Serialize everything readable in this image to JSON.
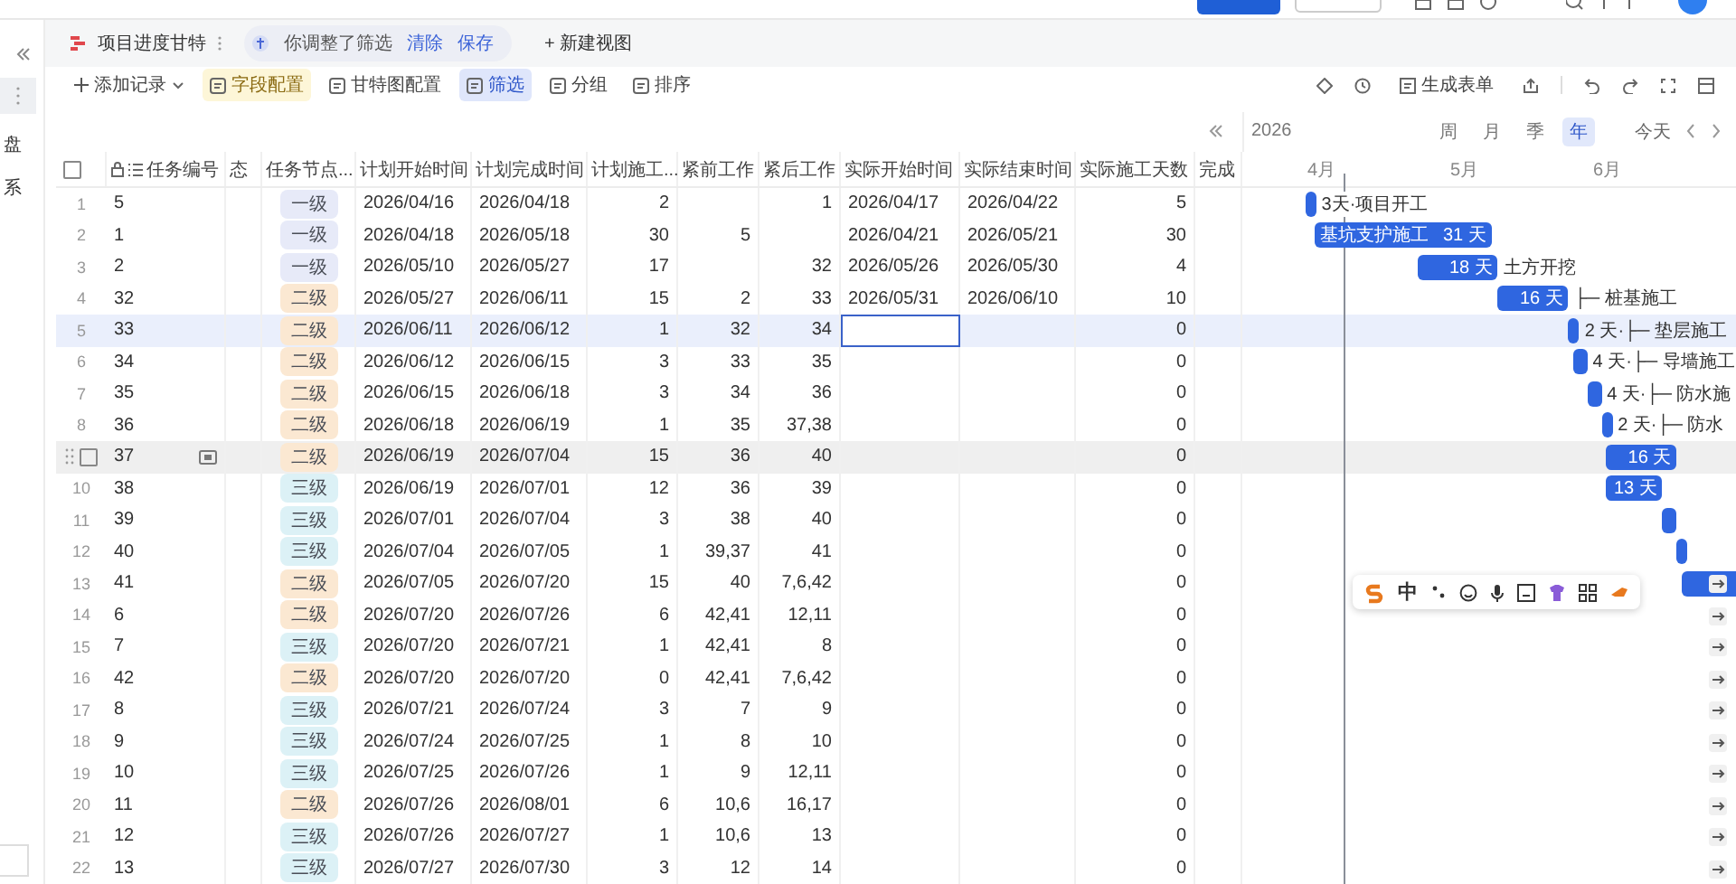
{
  "sidebar": {
    "items": [
      {
        "kind": "more",
        "selected": true
      },
      {
        "kind": "text",
        "label": "盘",
        "selected": false
      },
      {
        "kind": "text",
        "label": "系",
        "selected": false
      }
    ]
  },
  "view_tabs": {
    "title": "项目进度甘特",
    "notice": "你调整了筛选",
    "clear": "清除",
    "save": "保存",
    "new_view": "+ 新建视图"
  },
  "toolbar": {
    "left": [
      {
        "label": "添加记录",
        "kind": "add"
      },
      {
        "label": "字段配置",
        "kind": "warn"
      },
      {
        "label": "甘特图配置",
        "kind": "plain"
      },
      {
        "label": "筛选",
        "kind": "active"
      },
      {
        "label": "分组",
        "kind": "plain"
      },
      {
        "label": "排序",
        "kind": "plain"
      }
    ],
    "form": "生成表单"
  },
  "timeline": {
    "year": "2026",
    "scales": [
      {
        "label": "周",
        "selected": false
      },
      {
        "label": "月",
        "selected": false
      },
      {
        "label": "季",
        "selected": false
      },
      {
        "label": "年",
        "selected": true
      }
    ],
    "today": "今天"
  },
  "table": {
    "columns": [
      "任务编号",
      "态",
      "任务节点...",
      "计划开始时间",
      "计划完成时间",
      "计划施工...",
      "紧前工作",
      "紧后工作",
      "实际开始时间",
      "实际结束时间",
      "实际施工天数",
      "完成"
    ],
    "all_checked": false,
    "rows": [
      {
        "num": "1",
        "task_id": "5",
        "node": "一级",
        "color": "#e7eaf8",
        "plan_start": "2026/04/16",
        "plan_end": "2026/04/18",
        "plan_days": "2",
        "succ": "1",
        "act_start": "2026/04/17",
        "act_end": "2026/04/22",
        "act_days": "5",
        "selected": false,
        "hovered": false,
        "bar": {
          "outside": "3天·项目开工"
        }
      },
      {
        "num": "2",
        "task_id": "1",
        "node": "一级",
        "color": "#e7eaf8",
        "plan_start": "2026/04/18",
        "plan_end": "2026/05/18",
        "plan_days": "30",
        "pred": "5",
        "act_start": "2026/04/21",
        "act_end": "2026/05/21",
        "act_days": "30",
        "selected": false,
        "hovered": false,
        "bar": {
          "name": "基坑支护施工",
          "days": "31 天"
        }
      },
      {
        "num": "3",
        "task_id": "2",
        "node": "一级",
        "color": "#e7eaf8",
        "plan_start": "2026/05/10",
        "plan_end": "2026/05/27",
        "plan_days": "17",
        "succ": "32",
        "act_start": "2026/05/26",
        "act_end": "2026/05/30",
        "act_days": "4",
        "selected": false,
        "hovered": false,
        "bar": {
          "days": "18 天",
          "outside": "土方开挖"
        }
      },
      {
        "num": "4",
        "task_id": "32",
        "node": "二级",
        "color": "#fbe8d2",
        "plan_start": "2026/05/27",
        "plan_end": "2026/06/11",
        "plan_days": "15",
        "pred": "2",
        "succ": "33",
        "act_start": "2026/05/31",
        "act_end": "2026/06/10",
        "act_days": "10",
        "selected": false,
        "hovered": false,
        "bar": {
          "days": "16 天",
          "outside": "├─ 桩基施工"
        }
      },
      {
        "num": "5",
        "task_id": "33",
        "node": "二级",
        "color": "#fbe8d2",
        "plan_start": "2026/06/11",
        "plan_end": "2026/06/12",
        "plan_days": "1",
        "pred": "32",
        "succ": "34",
        "act_days": "0",
        "selected": true,
        "hovered": false,
        "focus_cell": true,
        "bar": {
          "outside": "2 天·├─ 垫层施工"
        }
      },
      {
        "num": "6",
        "task_id": "34",
        "node": "二级",
        "color": "#fbe8d2",
        "plan_start": "2026/06/12",
        "plan_end": "2026/06/15",
        "plan_days": "3",
        "pred": "33",
        "succ": "35",
        "act_days": "0",
        "selected": false,
        "hovered": false,
        "bar": {
          "outside": "4 天·├─ 导墙施工"
        }
      },
      {
        "num": "7",
        "task_id": "35",
        "node": "二级",
        "color": "#fbe8d2",
        "plan_start": "2026/06/15",
        "plan_end": "2026/06/18",
        "plan_days": "3",
        "pred": "34",
        "succ": "36",
        "act_days": "0",
        "selected": false,
        "hovered": false,
        "bar": {
          "outside": "4 天·├─ 防水施"
        }
      },
      {
        "num": "8",
        "task_id": "36",
        "node": "二级",
        "color": "#fbe8d2",
        "plan_start": "2026/06/18",
        "plan_end": "2026/06/19",
        "plan_days": "1",
        "pred": "35",
        "succ": "37,38",
        "act_days": "0",
        "selected": false,
        "hovered": false,
        "bar": {
          "outside": "2 天·├─ 防水"
        }
      },
      {
        "checked": false,
        "task_id": "37",
        "node": "二级",
        "color": "#fbe8d2",
        "plan_start": "2026/06/19",
        "plan_end": "2026/07/04",
        "plan_days": "15",
        "pred": "36",
        "succ": "40",
        "act_days": "0",
        "selected": false,
        "hovered": true,
        "bar": {
          "days": "16 天"
        }
      },
      {
        "num": "10",
        "task_id": "38",
        "node": "三级",
        "color": "#dcf1f6",
        "plan_start": "2026/06/19",
        "plan_end": "2026/07/01",
        "plan_days": "12",
        "pred": "36",
        "succ": "39",
        "act_days": "0",
        "selected": false,
        "hovered": false,
        "bar": {
          "days": "13 天"
        }
      },
      {
        "num": "11",
        "task_id": "39",
        "node": "三级",
        "color": "#dcf1f6",
        "plan_start": "2026/07/01",
        "plan_end": "2026/07/04",
        "plan_days": "3",
        "pred": "38",
        "succ": "40",
        "act_days": "0",
        "selected": false,
        "hovered": false
      },
      {
        "num": "12",
        "task_id": "40",
        "node": "三级",
        "color": "#dcf1f6",
        "plan_start": "2026/07/04",
        "plan_end": "2026/07/05",
        "plan_days": "1",
        "pred": "39,37",
        "succ": "41",
        "act_days": "0",
        "selected": false,
        "hovered": false
      },
      {
        "num": "13",
        "task_id": "41",
        "node": "二级",
        "color": "#fbe8d2",
        "plan_start": "2026/07/05",
        "plan_end": "2026/07/20",
        "plan_days": "15",
        "pred": "40",
        "succ": "7,6,42",
        "act_days": "0",
        "selected": false,
        "hovered": false
      },
      {
        "num": "14",
        "task_id": "6",
        "node": "二级",
        "color": "#fbe8d2",
        "plan_start": "2026/07/20",
        "plan_end": "2026/07/26",
        "plan_days": "6",
        "pred": "42,41",
        "succ": "12,11",
        "act_days": "0",
        "selected": false,
        "hovered": false
      },
      {
        "num": "15",
        "task_id": "7",
        "node": "三级",
        "color": "#dcf1f6",
        "plan_start": "2026/07/20",
        "plan_end": "2026/07/21",
        "plan_days": "1",
        "pred": "42,41",
        "succ": "8",
        "act_days": "0",
        "selected": false,
        "hovered": false
      },
      {
        "num": "16",
        "task_id": "42",
        "node": "二级",
        "color": "#fbe8d2",
        "plan_start": "2026/07/20",
        "plan_end": "2026/07/20",
        "plan_days": "0",
        "pred": "42,41",
        "succ": "7,6,42",
        "act_days": "0",
        "selected": false,
        "hovered": false
      },
      {
        "num": "17",
        "task_id": "8",
        "node": "三级",
        "color": "#dcf1f6",
        "plan_start": "2026/07/21",
        "plan_end": "2026/07/24",
        "plan_days": "3",
        "pred": "7",
        "succ": "9",
        "act_days": "0",
        "selected": false,
        "hovered": false
      },
      {
        "num": "18",
        "task_id": "9",
        "node": "三级",
        "color": "#dcf1f6",
        "plan_start": "2026/07/24",
        "plan_end": "2026/07/25",
        "plan_days": "1",
        "pred": "8",
        "succ": "10",
        "act_days": "0",
        "selected": false,
        "hovered": false
      },
      {
        "num": "19",
        "task_id": "10",
        "node": "三级",
        "color": "#dcf1f6",
        "plan_start": "2026/07/25",
        "plan_end": "2026/07/26",
        "plan_days": "1",
        "pred": "9",
        "succ": "12,11",
        "act_days": "0",
        "selected": false,
        "hovered": false
      },
      {
        "num": "20",
        "task_id": "11",
        "node": "二级",
        "color": "#fbe8d2",
        "plan_start": "2026/07/26",
        "plan_end": "2026/08/01",
        "plan_days": "6",
        "pred": "10,6",
        "succ": "16,17",
        "act_days": "0",
        "selected": false,
        "hovered": false
      },
      {
        "num": "21",
        "task_id": "12",
        "node": "三级",
        "color": "#dcf1f6",
        "plan_start": "2026/07/26",
        "plan_end": "2026/07/27",
        "plan_days": "1",
        "pred": "10,6",
        "succ": "13",
        "act_days": "0",
        "selected": false,
        "hovered": false
      },
      {
        "num": "22",
        "task_id": "13",
        "node": "三级",
        "color": "#dcf1f6",
        "plan_start": "2026/07/27",
        "plan_end": "2026/07/30",
        "plan_days": "3",
        "pred": "12",
        "succ": "14",
        "act_days": "0",
        "selected": false,
        "hovered": false
      }
    ]
  },
  "gantt": {
    "months": [
      "4月",
      "5月",
      "6月"
    ]
  },
  "ime_toolbar": {
    "mode": "中"
  }
}
